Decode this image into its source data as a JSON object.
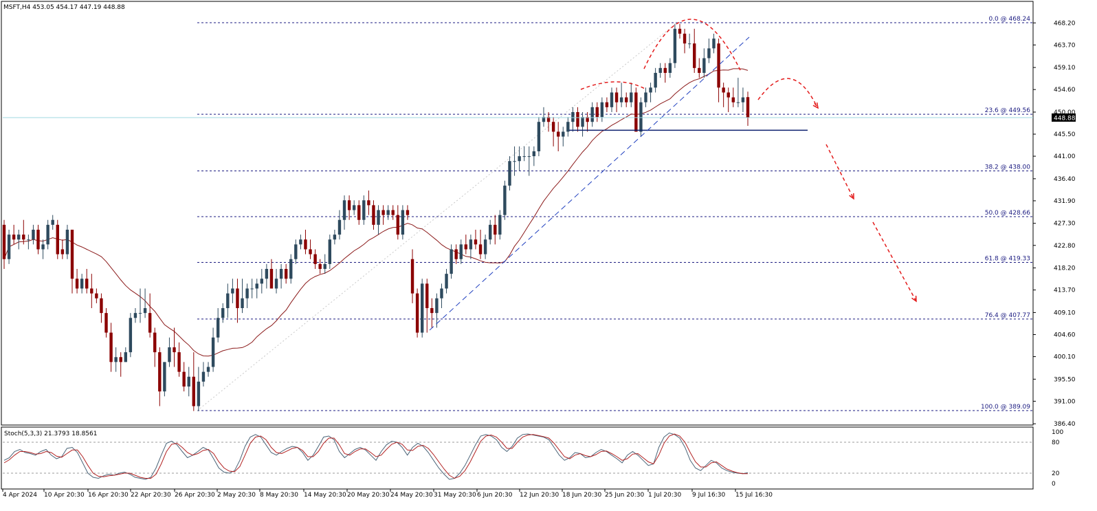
{
  "header": {
    "symbol_label": "MSFT,H4  453.05 454.17 447.19 448.88"
  },
  "stoch_header": {
    "label": "Stoch(5,3,3) 21.3793 18.8561"
  },
  "colors": {
    "bull": "#2e4a5e",
    "bear": "#8b0000",
    "ma": "#8b1a1a",
    "fib_line": "#1a1a80",
    "support": "#0b1f6e",
    "arrows": "#e31b1b",
    "trend": "#1f3fbf",
    "price_tag_bg": "#000000",
    "stoch_main": "#4a6478",
    "stoch_signal": "#b22222"
  },
  "chart_data": {
    "type": "candlestick",
    "title": "MSFT,H4",
    "ohlc_readout": {
      "open": 453.05,
      "high": 454.17,
      "low": 447.19,
      "close": 448.88
    },
    "price_axis": {
      "ticks": [
        "468.20",
        "463.70",
        "459.10",
        "454.60",
        "450.00",
        "445.50",
        "441.00",
        "436.40",
        "431.90",
        "427.30",
        "422.80",
        "418.20",
        "413.70",
        "409.10",
        "404.60",
        "400.10",
        "395.50",
        "391.00",
        "386.40"
      ]
    },
    "current_price_label": "448.88",
    "current_price": 448.88,
    "time_axis": {
      "ticks": [
        "4 Apr 2024",
        "10 Apr 20:30",
        "16 Apr 20:30",
        "22 Apr 20:30",
        "26 Apr 20:30",
        "2 May 20:30",
        "8 May 20:30",
        "14 May 20:30",
        "20 May 20:30",
        "24 May 20:30",
        "31 May 20:30",
        "6 Jun 20:30",
        "12 Jun 20:30",
        "18 Jun 20:30",
        "25 Jun 20:30",
        "1 Jul 20:30",
        "9 Jul 16:30",
        "15 Jul 16:30"
      ]
    },
    "fibonacci": [
      {
        "label": "0.0 @ 468.24",
        "price": 468.24
      },
      {
        "label": "23.6 @ 449.56",
        "price": 449.56
      },
      {
        "label": "38.2 @ 438.00",
        "price": 438.0
      },
      {
        "label": "50.0 @ 428.66",
        "price": 428.66
      },
      {
        "label": "61.8 @ 419.33",
        "price": 419.33
      },
      {
        "label": "76.4 @ 407.77",
        "price": 407.77
      },
      {
        "label": "100.0 @ 389.09",
        "price": 389.09
      }
    ],
    "support_level": 446.3,
    "candles": [
      [
        427,
        428,
        418,
        420
      ],
      [
        420,
        426,
        419,
        425
      ],
      [
        425,
        427,
        423,
        424
      ],
      [
        424,
        426,
        422,
        425
      ],
      [
        425,
        428,
        423,
        424
      ],
      [
        424,
        425,
        422,
        424
      ],
      [
        424,
        427,
        423,
        426
      ],
      [
        426,
        427,
        421,
        422
      ],
      [
        422,
        424,
        420,
        423
      ],
      [
        423,
        428,
        422,
        427
      ],
      [
        427,
        429,
        426,
        428
      ],
      [
        427,
        428,
        420,
        421
      ],
      [
        422,
        424,
        420,
        421
      ],
      [
        421,
        427,
        420,
        426
      ],
      [
        426,
        426,
        413,
        416
      ],
      [
        416,
        418,
        413,
        414
      ],
      [
        414,
        417,
        413,
        416
      ],
      [
        416,
        418,
        413,
        414
      ],
      [
        414,
        417,
        410,
        413
      ],
      [
        413,
        414,
        411,
        412
      ],
      [
        412,
        413,
        407,
        409
      ],
      [
        409,
        410,
        404,
        405
      ],
      [
        405,
        407,
        397,
        399
      ],
      [
        399,
        402,
        397,
        400
      ],
      [
        400,
        401,
        396,
        399
      ],
      [
        399,
        402,
        399,
        401
      ],
      [
        401,
        409,
        400,
        408
      ],
      [
        408,
        410,
        407,
        409
      ],
      [
        409,
        414,
        407,
        409
      ],
      [
        409,
        414,
        408,
        410
      ],
      [
        409,
        413,
        404,
        405
      ],
      [
        405,
        406,
        398,
        401
      ],
      [
        401,
        402,
        390,
        393
      ],
      [
        393,
        399,
        392,
        399
      ],
      [
        399,
        404,
        398,
        402
      ],
      [
        402,
        406,
        398,
        401
      ],
      [
        401,
        403,
        396,
        397
      ],
      [
        397,
        399,
        393,
        394
      ],
      [
        394,
        398,
        392,
        396
      ],
      [
        396,
        401,
        389,
        390
      ],
      [
        390,
        398,
        389,
        395
      ],
      [
        395,
        399,
        394,
        397
      ],
      [
        397,
        399,
        396,
        398
      ],
      [
        398,
        406,
        397,
        404
      ],
      [
        404,
        410,
        403,
        408
      ],
      [
        408,
        411,
        407,
        410
      ],
      [
        410,
        415,
        408,
        413
      ],
      [
        413,
        416,
        411,
        414
      ],
      [
        414,
        416,
        407,
        410
      ],
      [
        410,
        416,
        409,
        412
      ],
      [
        412,
        415,
        410,
        414
      ],
      [
        414,
        416,
        412,
        414
      ],
      [
        414,
        416,
        412,
        415
      ],
      [
        415,
        418,
        413,
        416
      ],
      [
        416,
        419,
        414,
        418
      ],
      [
        418,
        420,
        414,
        414
      ],
      [
        414,
        418,
        413,
        416
      ],
      [
        416,
        419,
        414,
        418
      ],
      [
        418,
        419,
        415,
        416
      ],
      [
        416,
        421,
        415,
        420
      ],
      [
        420,
        424,
        419,
        423
      ],
      [
        423,
        425,
        422,
        424
      ],
      [
        424,
        426,
        421,
        422
      ],
      [
        422,
        424,
        420,
        421
      ],
      [
        421,
        422,
        418,
        419
      ],
      [
        419,
        420,
        417,
        418
      ],
      [
        418,
        421,
        417,
        419
      ],
      [
        419,
        425,
        418,
        424
      ],
      [
        424,
        426,
        423,
        425
      ],
      [
        425,
        430,
        424,
        428
      ],
      [
        428,
        433,
        426,
        432
      ],
      [
        432,
        433,
        428,
        430
      ],
      [
        430,
        432,
        429,
        431
      ],
      [
        431,
        432,
        427,
        428
      ],
      [
        428,
        433,
        427,
        432
      ],
      [
        432,
        434,
        429,
        431
      ],
      [
        431,
        432,
        426,
        427
      ],
      [
        427,
        431,
        425,
        430
      ],
      [
        430,
        431,
        427,
        429
      ],
      [
        429,
        431,
        428,
        430
      ],
      [
        430,
        431,
        428,
        429
      ],
      [
        429,
        431,
        424,
        425
      ],
      [
        425,
        431,
        424,
        430
      ],
      [
        430,
        431,
        428,
        429
      ],
      [
        420,
        422,
        411,
        413
      ],
      [
        413,
        414,
        404,
        405
      ],
      [
        405,
        416,
        404,
        415
      ],
      [
        415,
        416,
        405,
        410
      ],
      [
        410,
        412,
        406,
        409
      ],
      [
        409,
        413,
        406,
        412
      ],
      [
        412,
        415,
        410,
        414
      ],
      [
        414,
        418,
        413,
        417
      ],
      [
        417,
        423,
        416,
        422
      ],
      [
        422,
        423,
        419,
        420
      ],
      [
        420,
        424,
        419,
        423
      ],
      [
        423,
        425,
        421,
        422
      ],
      [
        422,
        425,
        420,
        424
      ],
      [
        424,
        426,
        422,
        423
      ],
      [
        423,
        426,
        420,
        421
      ],
      [
        421,
        425,
        420,
        424
      ],
      [
        424,
        428,
        423,
        427
      ],
      [
        427,
        429,
        423,
        425
      ],
      [
        425,
        430,
        424,
        429
      ],
      [
        429,
        436,
        428,
        435
      ],
      [
        435,
        441,
        434,
        440
      ],
      [
        440,
        443,
        437,
        440
      ],
      [
        440,
        443,
        438,
        441
      ],
      [
        441,
        443,
        440,
        441
      ],
      [
        441,
        443,
        437,
        441
      ],
      [
        441,
        443,
        439,
        442
      ],
      [
        442,
        449,
        441,
        448
      ],
      [
        448,
        451,
        447,
        449
      ],
      [
        449,
        450,
        446,
        448
      ],
      [
        448,
        449,
        443,
        446
      ],
      [
        446,
        448,
        442,
        445
      ],
      [
        445,
        447,
        443,
        446
      ],
      [
        446,
        449,
        445,
        448
      ],
      [
        448,
        451,
        446,
        450
      ],
      [
        450,
        451,
        446,
        447
      ],
      [
        447,
        450,
        445,
        449
      ],
      [
        449,
        450,
        446,
        448
      ],
      [
        448,
        452,
        447,
        451
      ],
      [
        451,
        452,
        448,
        449
      ],
      [
        449,
        453,
        448,
        452
      ],
      [
        452,
        453,
        450,
        451
      ],
      [
        451,
        455,
        450,
        454
      ],
      [
        454,
        455,
        450,
        452
      ],
      [
        452,
        456,
        451,
        453
      ],
      [
        453,
        454,
        451,
        452
      ],
      [
        452,
        456,
        451,
        454
      ],
      [
        454,
        455,
        447,
        446
      ],
      [
        446,
        453,
        445,
        452
      ],
      [
        452,
        455,
        451,
        454
      ],
      [
        454,
        456,
        452,
        455
      ],
      [
        455,
        459,
        454,
        458
      ],
      [
        458,
        460,
        457,
        459
      ],
      [
        459,
        460,
        456,
        458
      ],
      [
        458,
        461,
        457,
        460
      ],
      [
        460,
        468,
        459,
        467
      ],
      [
        467,
        468,
        465,
        466
      ],
      [
        466,
        467,
        462,
        464
      ],
      [
        464,
        466,
        463,
        464
      ],
      [
        464,
        467,
        458,
        459
      ],
      [
        459,
        461,
        457,
        458
      ],
      [
        458,
        463,
        457,
        461
      ],
      [
        461,
        465,
        460,
        463
      ],
      [
        463,
        466,
        462,
        465
      ],
      [
        464,
        465,
        452,
        455
      ],
      [
        455,
        456,
        451,
        454
      ],
      [
        454,
        455,
        450,
        453
      ],
      [
        453,
        455,
        451,
        452
      ],
      [
        452,
        457,
        451,
        452
      ],
      [
        452,
        455,
        450,
        453
      ],
      [
        453.05,
        454.17,
        447.19,
        448.88
      ]
    ],
    "stochastic": {
      "label": "Stoch(5,3,3)",
      "main_value": 21.3793,
      "signal_value": 18.8561,
      "axis_ticks": [
        "100",
        "80",
        "20",
        "0"
      ],
      "levels": [
        80,
        20
      ],
      "main": [
        45,
        50,
        62,
        66,
        60,
        58,
        55,
        62,
        66,
        55,
        48,
        52,
        68,
        70,
        60,
        40,
        20,
        12,
        10,
        15,
        18,
        16,
        20,
        22,
        18,
        12,
        10,
        8,
        12,
        30,
        55,
        78,
        82,
        75,
        62,
        50,
        55,
        62,
        70,
        65,
        48,
        30,
        22,
        20,
        25,
        45,
        72,
        90,
        95,
        90,
        75,
        60,
        55,
        62,
        68,
        72,
        70,
        60,
        45,
        55,
        72,
        90,
        92,
        85,
        62,
        50,
        58,
        66,
        70,
        65,
        55,
        45,
        62,
        75,
        82,
        80,
        70,
        55,
        70,
        78,
        72,
        60,
        45,
        30,
        18,
        8,
        10,
        20,
        35,
        55,
        75,
        92,
        95,
        92,
        85,
        70,
        62,
        72,
        88,
        95,
        96,
        94,
        92,
        90,
        85,
        70,
        55,
        45,
        50,
        60,
        58,
        50,
        52,
        60,
        66,
        62,
        55,
        48,
        40,
        55,
        62,
        55,
        45,
        35,
        38,
        70,
        90,
        98,
        95,
        88,
        70,
        45,
        30,
        25,
        35,
        45,
        40,
        30,
        25,
        22,
        20,
        19,
        21
      ],
      "signal": [
        40,
        46,
        55,
        62,
        62,
        60,
        57,
        58,
        62,
        60,
        53,
        51,
        58,
        65,
        65,
        52,
        35,
        20,
        14,
        13,
        15,
        16,
        18,
        20,
        20,
        16,
        12,
        10,
        10,
        18,
        38,
        62,
        76,
        78,
        70,
        60,
        55,
        58,
        64,
        66,
        58,
        42,
        30,
        24,
        23,
        33,
        55,
        78,
        90,
        92,
        85,
        70,
        60,
        58,
        63,
        68,
        70,
        64,
        52,
        52,
        62,
        78,
        88,
        88,
        75,
        58,
        55,
        62,
        67,
        67,
        60,
        52,
        55,
        66,
        76,
        80,
        76,
        65,
        64,
        72,
        74,
        68,
        56,
        42,
        28,
        16,
        10,
        14,
        25,
        42,
        62,
        82,
        92,
        94,
        90,
        80,
        68,
        68,
        80,
        90,
        94,
        95,
        93,
        91,
        88,
        78,
        65,
        52,
        48,
        55,
        58,
        54,
        52,
        56,
        62,
        63,
        58,
        52,
        45,
        48,
        57,
        58,
        50,
        42,
        38,
        55,
        78,
        92,
        96,
        92,
        80,
        60,
        42,
        32,
        32,
        40,
        42,
        35,
        28,
        24,
        21,
        19,
        19
      ]
    }
  }
}
